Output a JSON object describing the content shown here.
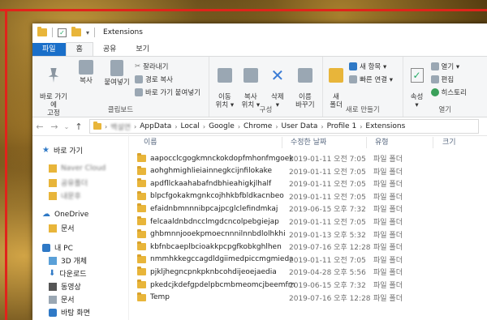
{
  "window": {
    "title": "Extensions"
  },
  "tabs": [
    "파일",
    "홈",
    "공유",
    "보기"
  ],
  "ribbon": {
    "clipboard": {
      "pin_label": "바로 가기에\n고정",
      "copy_label": "복사",
      "paste_label": "붙여넣기",
      "cut_label": "잘라내기",
      "copy_path_label": "경로 복사",
      "paste_shortcut_label": "바로 가기 붙여넣기",
      "group_label": "클립보드"
    },
    "organize": {
      "move_label": "이동\n위치 ▾",
      "copyto_label": "복사\n위치 ▾",
      "delete_label": "삭제\n▾",
      "rename_label": "이름\n바꾸기",
      "group_label": "구성"
    },
    "new": {
      "folder_label": "새\n폴더",
      "new_item_label": "새 항목 ▾",
      "easy_access_label": "빠른 연결 ▾",
      "group_label": "새로 만들기"
    },
    "open": {
      "properties_label": "속성\n▾",
      "open_label": "열기 ▾",
      "edit_label": "편집",
      "history_label": "히스토리",
      "group_label": "열기"
    }
  },
  "address": {
    "blurred_segment": "백설연",
    "path": [
      "AppData",
      "Local",
      "Google",
      "Chrome",
      "User Data",
      "Profile 1",
      "Extensions"
    ]
  },
  "nav": {
    "quick_access": "바로 가기",
    "blurred_items": [
      "Naver Cloud",
      "공유폴더",
      "내문후"
    ],
    "onedrive": "OneDrive",
    "onedrive_docs": "문서",
    "this_pc": "내 PC",
    "pc_items": [
      "3D 개체",
      "다운로드",
      "동영상",
      "문서",
      "바탕 화면"
    ]
  },
  "columns": {
    "name": "이름",
    "date": "수정한 날짜",
    "type": "유형",
    "size": "크기"
  },
  "files": [
    {
      "name": "aapocclcgogkmnckokdopfmhonfmgoek",
      "date": "2019-01-11 오전 7:05",
      "type": "파일 폴더"
    },
    {
      "name": "aohghmighlieiainnegkcijnfilokake",
      "date": "2019-01-11 오전 7:05",
      "type": "파일 폴더"
    },
    {
      "name": "apdfllckaahabafndbhieahigkjlhalf",
      "date": "2019-01-11 오전 7:05",
      "type": "파일 폴더"
    },
    {
      "name": "blpcfgokakmgnkcojhhkbfbldkacnbeo",
      "date": "2019-01-11 오전 7:05",
      "type": "파일 폴더"
    },
    {
      "name": "efaidnbmnnnibpcajpcglclefindmkaj",
      "date": "2019-06-15 오후 7:32",
      "type": "파일 폴더"
    },
    {
      "name": "felcaaldnbdncclmgdcncolpebgiejap",
      "date": "2019-01-11 오전 7:05",
      "type": "파일 폴더"
    },
    {
      "name": "ghbmnnjooekpmoecnnnilnnbdlolhkhi",
      "date": "2019-01-13 오후 5:32",
      "type": "파일 폴더"
    },
    {
      "name": "kbfnbcaeplbcioakkpcpgfkobkghlhen",
      "date": "2019-07-16 오후 12:28",
      "type": "파일 폴더"
    },
    {
      "name": "nmmhkkegccagdldgiimedpiccmgmieda",
      "date": "2019-01-11 오전 7:05",
      "type": "파일 폴더"
    },
    {
      "name": "pjkljhegncpnkpknbcohdijeoejaedia",
      "date": "2019-04-28 오후 5:56",
      "type": "파일 폴더"
    },
    {
      "name": "pkedcjkdefgpdelpbcmbmeomcjbeemfm",
      "date": "2019-06-15 오후 7:32",
      "type": "파일 폴더"
    },
    {
      "name": "Temp",
      "date": "2019-07-16 오후 12:28",
      "type": "파일 폴더"
    }
  ],
  "colors": {
    "accent": "#1a6fc9",
    "folder": "#e8b53a",
    "frame": "#e1231b"
  }
}
